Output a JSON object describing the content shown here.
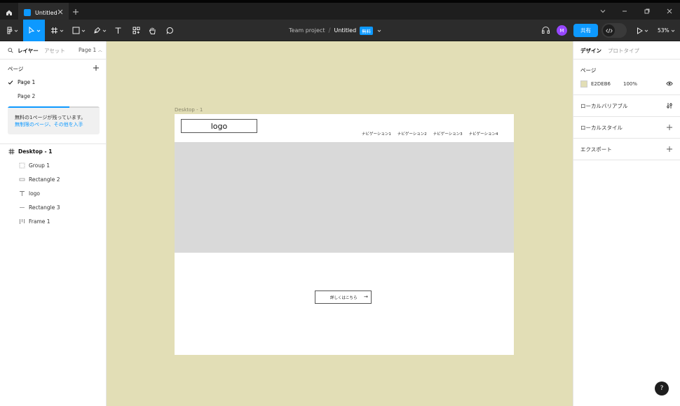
{
  "titlebar": {
    "tab_title": "Untitled"
  },
  "toolbar": {
    "team_name": "Team project",
    "file_name": "Untitled",
    "plan_badge": "無料",
    "share_label": "共有",
    "avatar_initial": "M",
    "zoom": "53%"
  },
  "left_panel": {
    "tab_layers": "レイヤー",
    "tab_assets": "アセット",
    "current_page": "Page 1",
    "pages_title": "ページ",
    "pages": [
      {
        "name": "Page 1",
        "selected": true
      },
      {
        "name": "Page 2",
        "selected": false
      }
    ],
    "upsell": {
      "text": "無料の1ページが残っています。",
      "link": "無制限のページ、その他を入手",
      "progress": 0.67
    },
    "layers": [
      {
        "name": "Desktop - 1",
        "icon": "frame-icon",
        "level": 0
      },
      {
        "name": "Group 1",
        "icon": "group-icon",
        "level": 1
      },
      {
        "name": "Rectangle 2",
        "icon": "rectangle-icon",
        "level": 1
      },
      {
        "name": "logo",
        "icon": "text-icon",
        "level": 1
      },
      {
        "name": "Rectangle 3",
        "icon": "line-icon",
        "level": 1
      },
      {
        "name": "Frame 1",
        "icon": "autolayout-icon",
        "level": 1
      }
    ]
  },
  "canvas": {
    "background": "#E2DEB6",
    "frame_label": "Desktop - 1",
    "logo_text": "logo",
    "nav_items": [
      "ナビゲーション1",
      "ナビゲーション2",
      "ナビゲーション3",
      "ナビゲーション4"
    ],
    "cta_label": "詳しくはこちら",
    "cta_arrow": "→"
  },
  "right_panel": {
    "tab_design": "デザイン",
    "tab_prototype": "プロトタイプ",
    "page_section": "ページ",
    "page_color_hex": "E2DEB6",
    "page_color_opacity": "100%",
    "local_variables": "ローカルバリアブル",
    "local_styles": "ローカルスタイル",
    "export": "エクスポート"
  },
  "help": "?"
}
